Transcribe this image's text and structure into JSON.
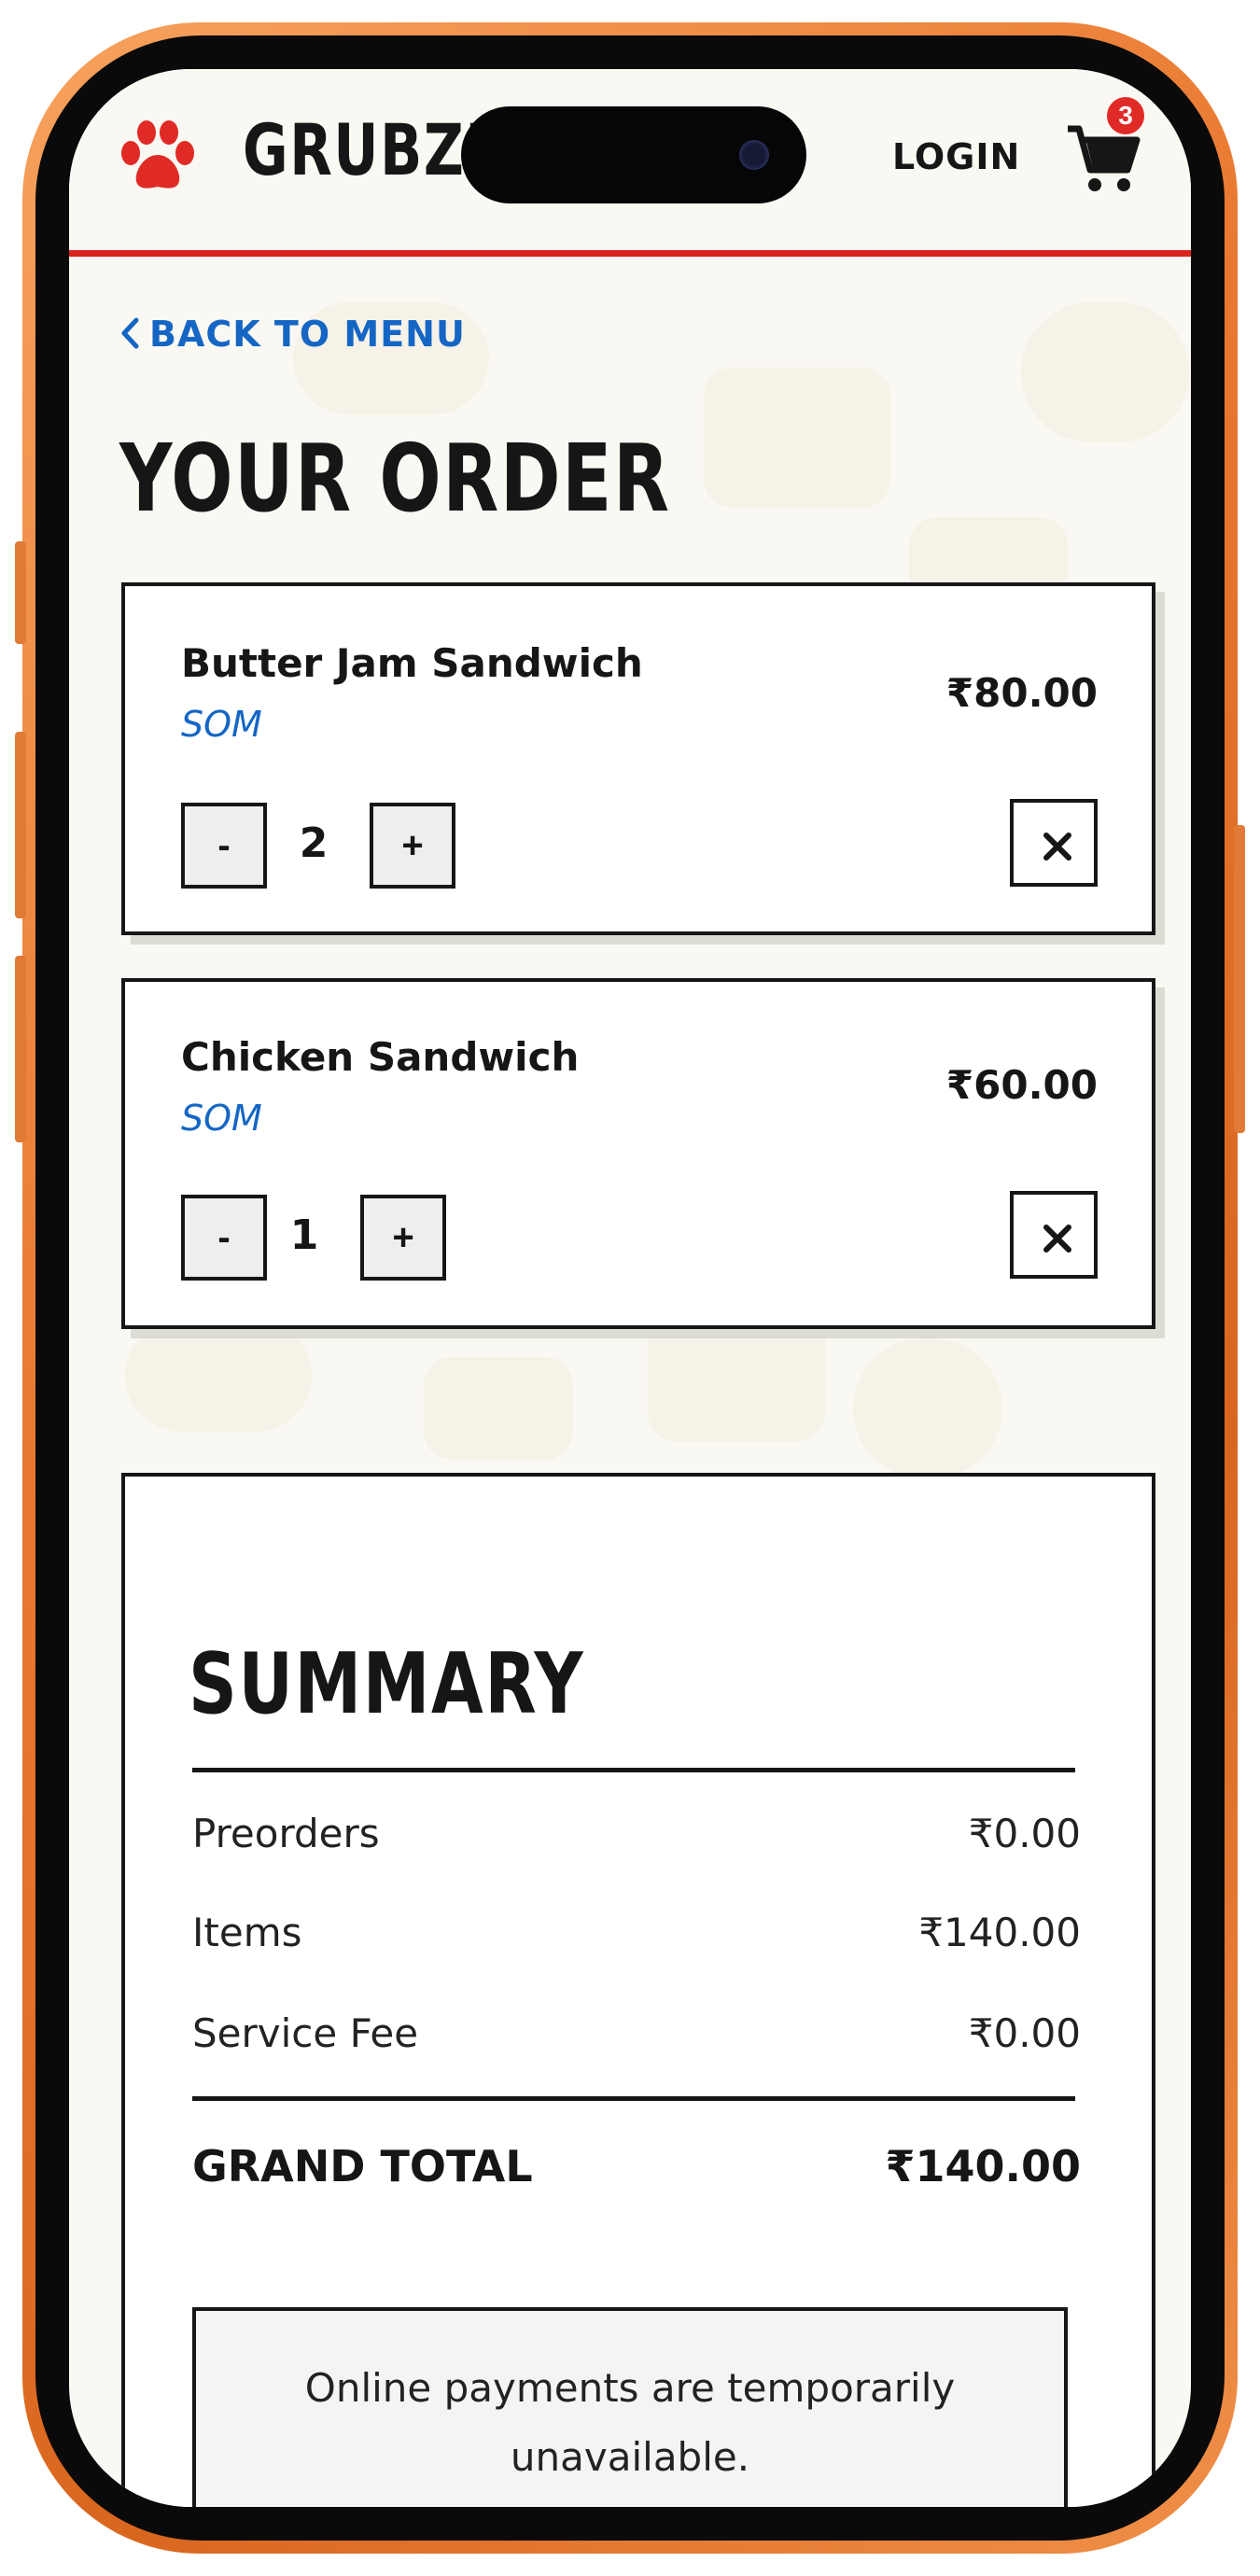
{
  "header": {
    "brand": "GRUBZI",
    "login_label": "LOGIN",
    "cart_count": "3"
  },
  "nav": {
    "back_label": "BACK TO MENU"
  },
  "page_title": "YOUR ORDER",
  "items": [
    {
      "name": "Butter Jam Sandwich",
      "vendor": "SOM",
      "price": "₹80.00",
      "qty": "2",
      "minus": "-",
      "plus": "+"
    },
    {
      "name": "Chicken Sandwich",
      "vendor": "SOM",
      "price": "₹60.00",
      "qty": "1",
      "minus": "-",
      "plus": "+"
    }
  ],
  "summary": {
    "title": "SUMMARY",
    "rows": [
      {
        "label": "Preorders",
        "value": "₹0.00"
      },
      {
        "label": "Items",
        "value": "₹140.00"
      },
      {
        "label": "Service Fee",
        "value": "₹0.00"
      }
    ],
    "grand_total_label": "GRAND TOTAL",
    "grand_total_value": "₹140.00",
    "notice": "Online payments are temporarily unavailable."
  },
  "colors": {
    "accent_red": "#d8241c",
    "link_blue": "#1566c4",
    "phone_frame": "#e8772f"
  }
}
